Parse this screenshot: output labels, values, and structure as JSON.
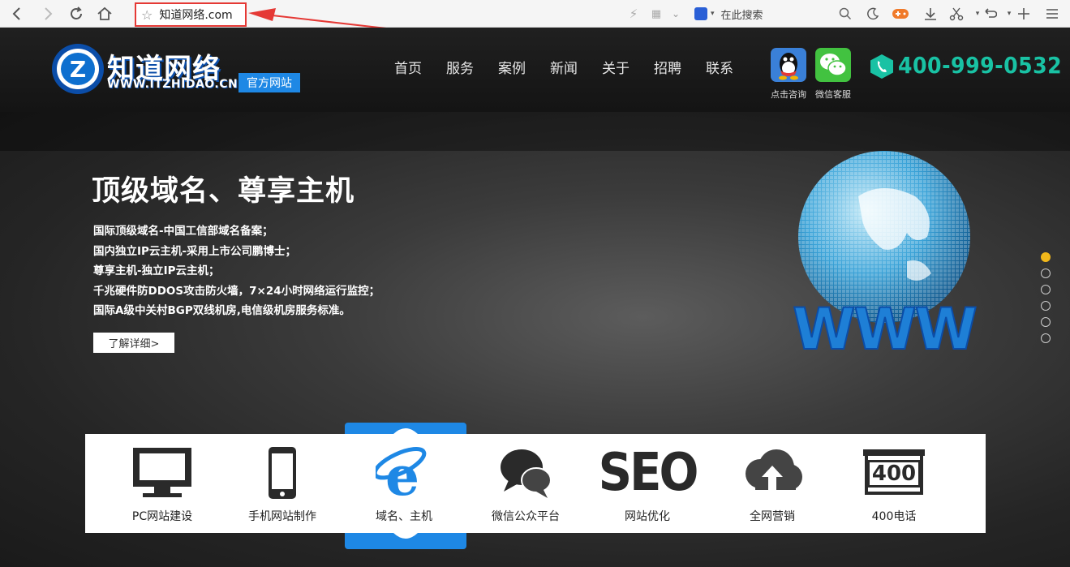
{
  "browser": {
    "address": "知道网络.com",
    "search_placeholder": "在此搜索"
  },
  "brand": {
    "logo_text": "知道网络",
    "logo_url": "WWW.ITZHIDAO.CN",
    "official_badge": "官方网站",
    "accent": "#1e88e5"
  },
  "nav": {
    "items": [
      "首页",
      "服务",
      "案例",
      "新闻",
      "关于",
      "招聘",
      "联系"
    ]
  },
  "contact": {
    "qq_label": "点击咨询",
    "wechat_label": "微信客服",
    "phone": "400-999-0532",
    "phone_color": "#19c2a4"
  },
  "hero": {
    "title": "顶级域名、尊享主机",
    "lines": [
      "国际顶级域名-中国工信部域名备案；",
      "国内独立IP云主机-采用上市公司鹏博士；",
      "尊享主机-独立IP云主机；",
      "千兆硬件防DDOS攻击防火墙，7×24小时网络运行监控；",
      "国际A级中关村BGP双线机房,电信级机房服务标准。"
    ],
    "button": "了解详细>",
    "globe_text": "WWW",
    "slides": 6,
    "active_slide": 1
  },
  "services": [
    {
      "name": "PC网站建设",
      "icon": "monitor-icon"
    },
    {
      "name": "手机网站制作",
      "icon": "mobile-icon"
    },
    {
      "name": "域名、主机",
      "icon": "ie-icon"
    },
    {
      "name": "微信公众平台",
      "icon": "chat-icon"
    },
    {
      "name": "网站优化",
      "icon": "seo-icon",
      "icon_text": "SEO"
    },
    {
      "name": "全网营销",
      "icon": "cloud-upload-icon"
    },
    {
      "name": "400电话",
      "icon": "phone400-icon",
      "icon_text": "400"
    }
  ]
}
